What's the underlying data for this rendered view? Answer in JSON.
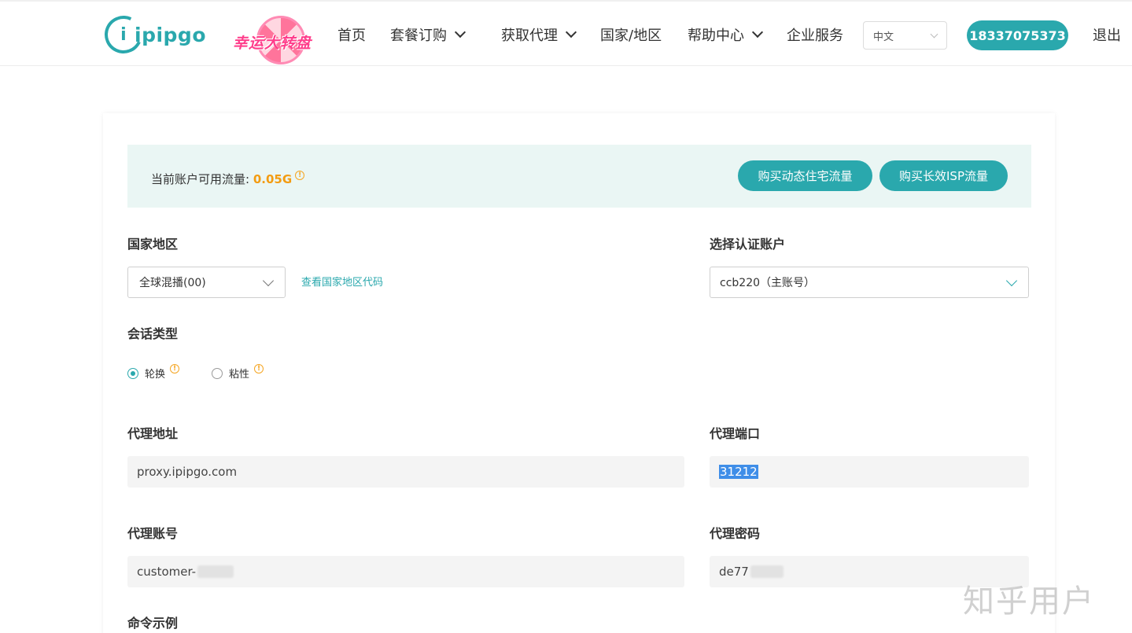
{
  "header": {
    "logo_text": "ipipgo",
    "logo_glyph": "i",
    "promo_text": "幸运大转盘",
    "nav": [
      {
        "label": "首页"
      },
      {
        "label": "套餐订购"
      },
      {
        "label": "获取代理"
      },
      {
        "label": "国家/地区"
      },
      {
        "label": "帮助中心"
      },
      {
        "label": "企业服务"
      }
    ],
    "language": "中文",
    "phone": "18337075373",
    "logout": "退出"
  },
  "banner": {
    "label": "当前账户可用流量: ",
    "value": "0.05G",
    "buy_dynamic": "购买动态住宅流量",
    "buy_isp": "购买长效ISP流量"
  },
  "form": {
    "country_label": "国家地区",
    "country_value": "全球混播(00)",
    "country_link": "查看国家地区代码",
    "account_label": "选择认证账户",
    "account_value": "ccb220（主账号）",
    "session_label": "会话类型",
    "session_options": [
      {
        "label": "轮换",
        "checked": true
      },
      {
        "label": "粘性",
        "checked": false
      }
    ],
    "proxy_address_label": "代理地址",
    "proxy_address_value": "proxy.ipipgo.com",
    "proxy_port_label": "代理端口",
    "proxy_port_value": "31212",
    "proxy_account_label": "代理账号",
    "proxy_account_value": "customer-",
    "proxy_password_label": "代理密码",
    "proxy_password_value": "de77",
    "command_label": "命令示例"
  },
  "watermark": "知乎用户",
  "colors": {
    "accent": "#2aa8ad",
    "highlight": "#f39c12",
    "banner_bg": "#eaf6f4"
  }
}
